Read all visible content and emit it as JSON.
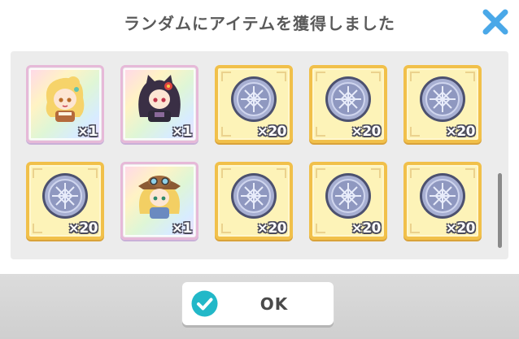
{
  "dialog": {
    "title": "ランダムにアイテムを獲得しました",
    "close_icon": "close-x-icon",
    "ok_label": "OK",
    "ok_icon": "check-circle-icon"
  },
  "items": [
    {
      "kind": "character",
      "icon": "character-blonde-girl",
      "quantity": "×1"
    },
    {
      "kind": "character",
      "icon": "character-dark-haired-girl",
      "quantity": "×1"
    },
    {
      "kind": "coin",
      "icon": "silver-medal-coin-icon",
      "quantity": "×20"
    },
    {
      "kind": "coin",
      "icon": "silver-medal-coin-icon",
      "quantity": "×20"
    },
    {
      "kind": "coin",
      "icon": "silver-medal-coin-icon",
      "quantity": "×20"
    },
    {
      "kind": "coin",
      "icon": "silver-medal-coin-icon",
      "quantity": "×20"
    },
    {
      "kind": "character",
      "icon": "character-cowgirl-goggles",
      "quantity": "×1"
    },
    {
      "kind": "coin",
      "icon": "silver-medal-coin-icon",
      "quantity": "×20"
    },
    {
      "kind": "coin",
      "icon": "silver-medal-coin-icon",
      "quantity": "×20"
    },
    {
      "kind": "coin",
      "icon": "silver-medal-coin-icon",
      "quantity": "×20"
    }
  ],
  "colors": {
    "close_icon": "#4aa8e8",
    "ok_check": "#22b8c8",
    "gold_frame": "#f1c04a",
    "coin": "#9aa3c8"
  }
}
